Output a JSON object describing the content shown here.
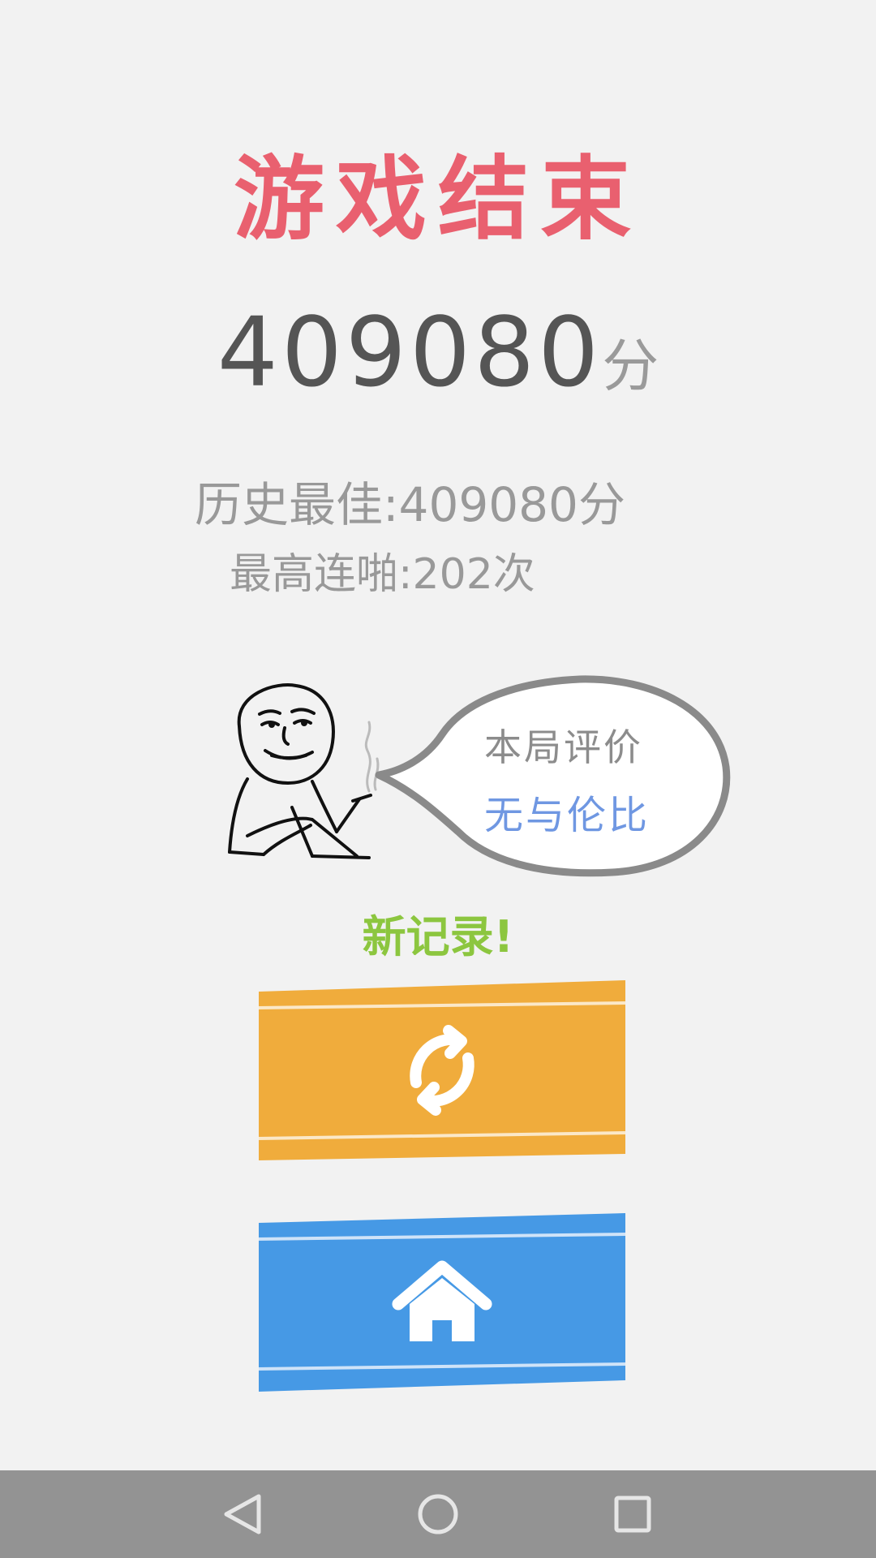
{
  "title": "游戏结束",
  "score": {
    "value": "409080",
    "unit": "分"
  },
  "stats": {
    "best": "历史最佳:409080分",
    "max_combo": "最高连啪:202次"
  },
  "evaluation": {
    "label": "本局评价",
    "rating": "无与伦比"
  },
  "new_record": "新记录!",
  "buttons": {
    "restart_icon": "restart-icon",
    "home_icon": "home-icon"
  },
  "colors": {
    "title": "#e9606f",
    "score": "#555555",
    "muted_text": "#999999",
    "rating": "#6f97e2",
    "new_record": "#8cc63f",
    "restart_button": "#f0ac3c",
    "home_button": "#4699e5",
    "background": "#f2f2f2",
    "navbar": "#939393"
  },
  "navbar": {
    "icons": [
      "back-triangle-icon",
      "home-circle-icon",
      "recent-square-icon"
    ]
  }
}
